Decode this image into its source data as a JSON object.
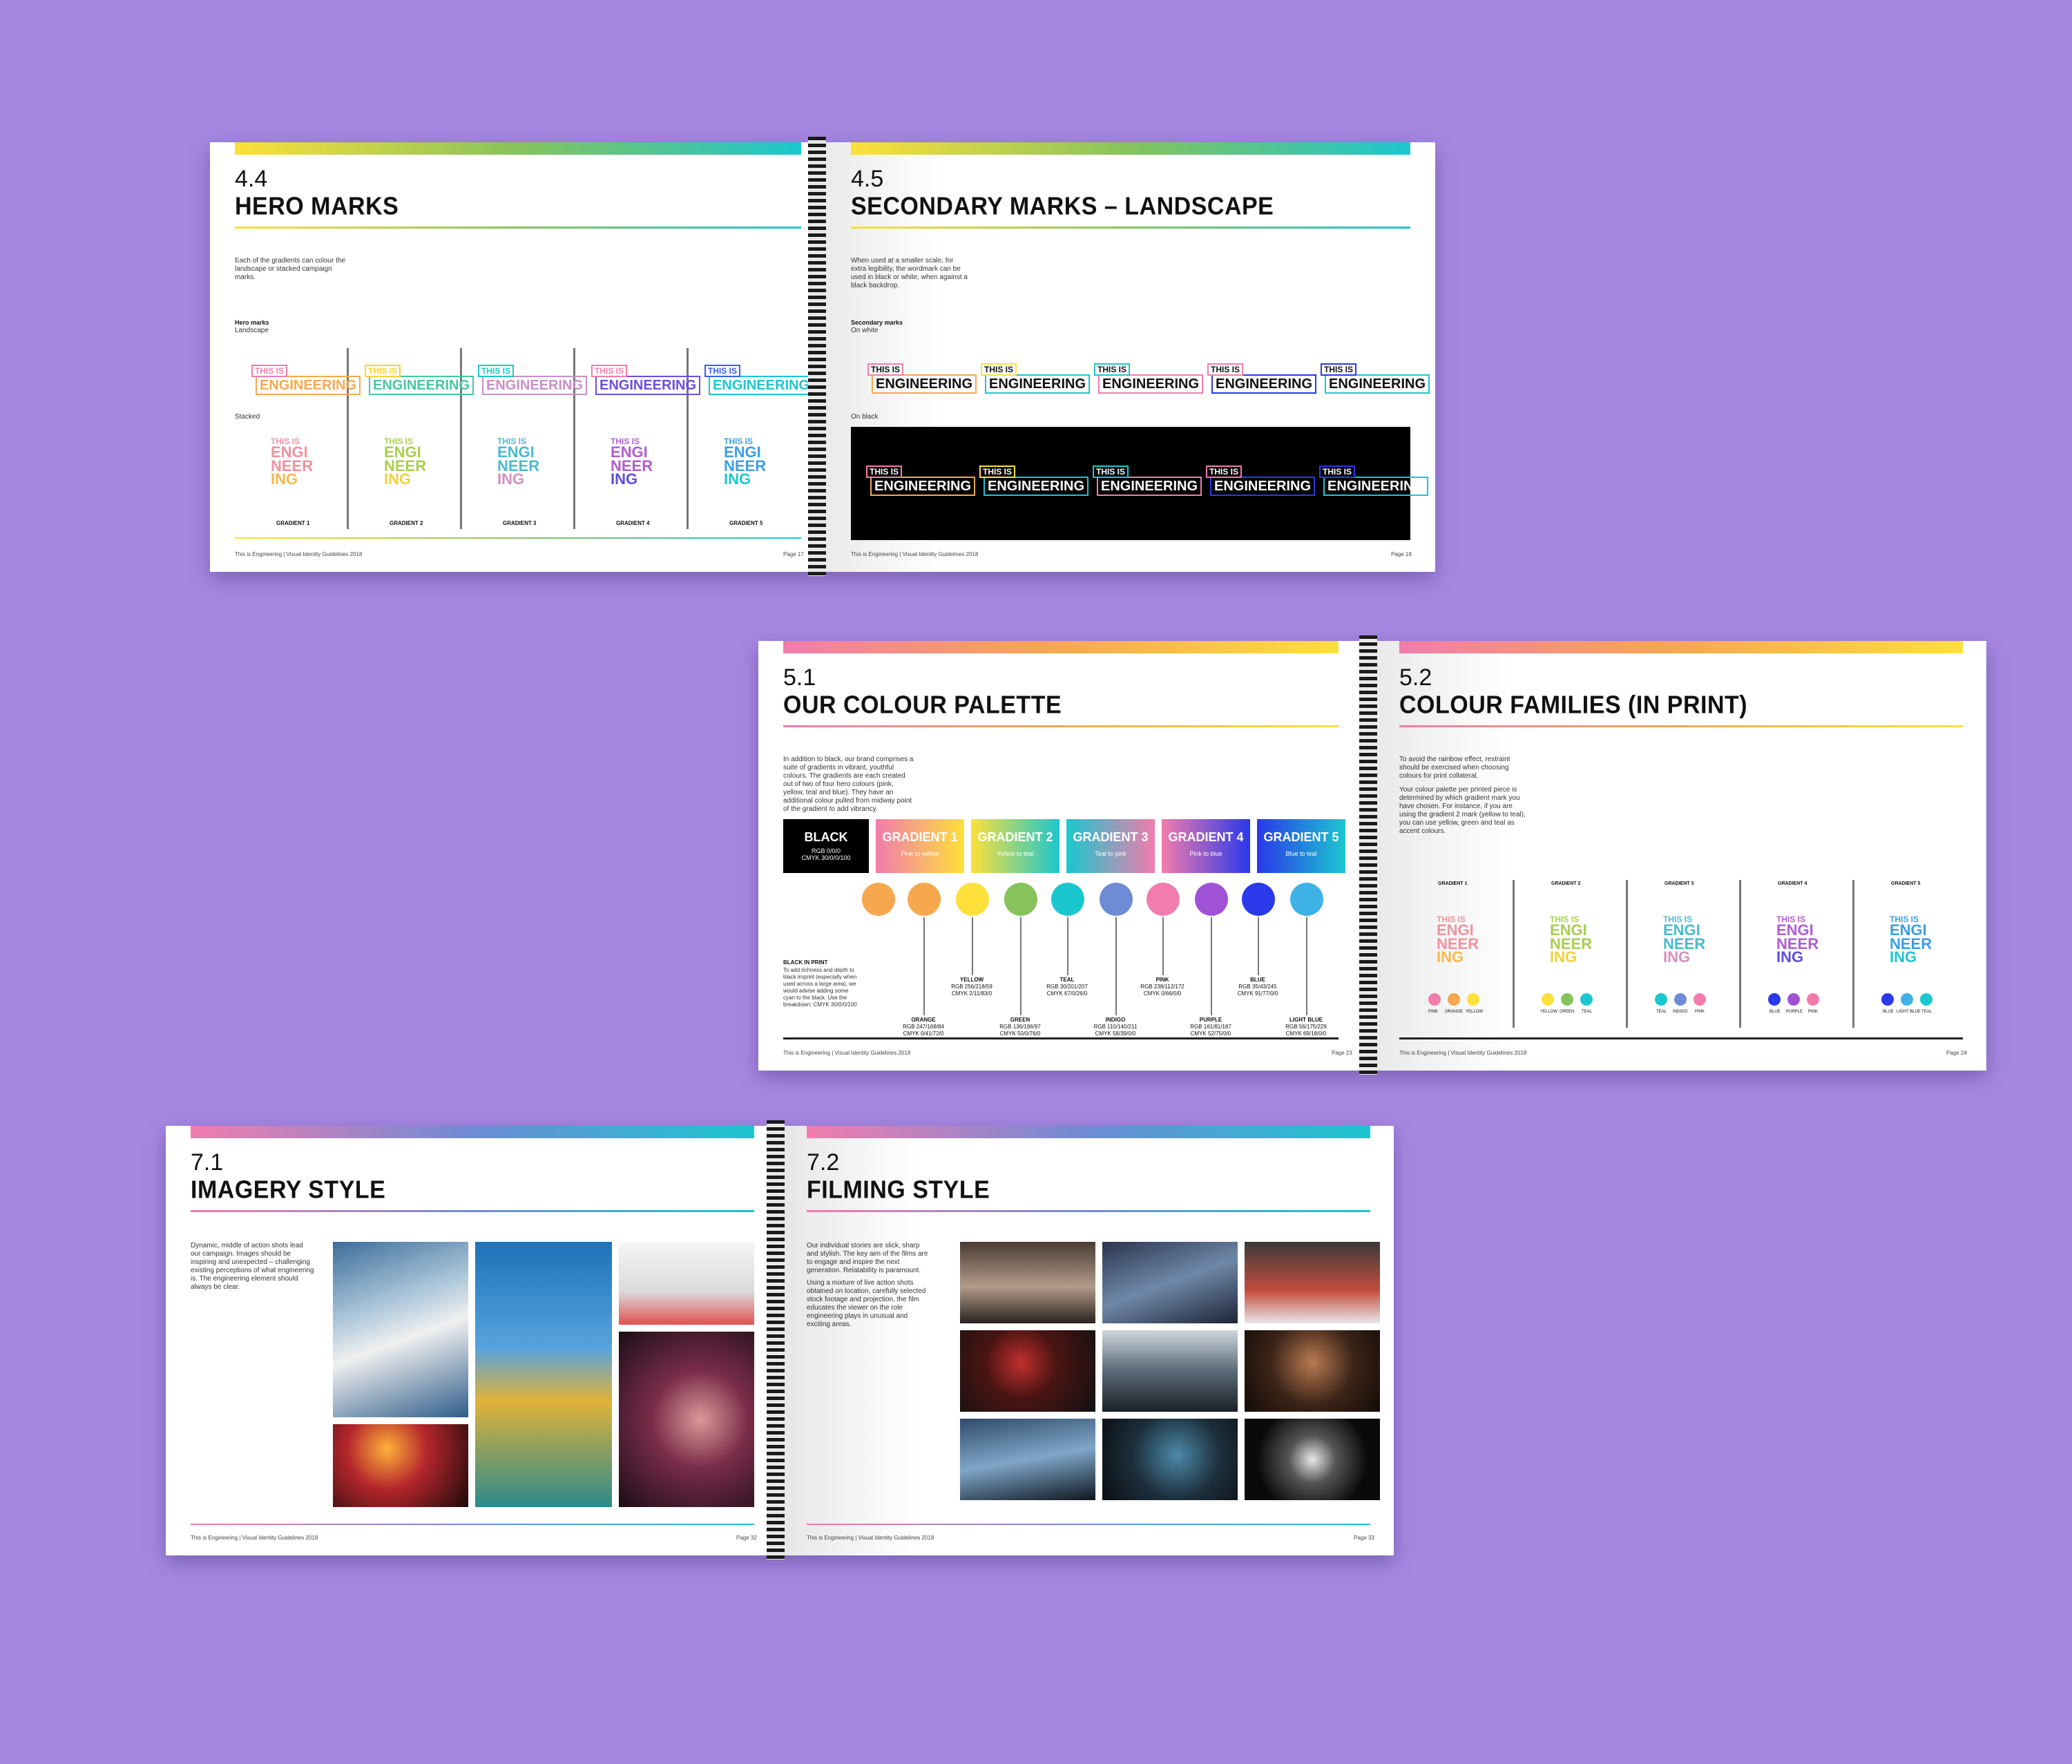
{
  "colors": {
    "background": "#a688e3",
    "pink": "#f27cad",
    "orange": "#f7a84e",
    "yellow": "#fde03a",
    "green": "#86c35b",
    "teal": "#1bc7cf",
    "indigo": "#6e8bd6",
    "purple": "#a052d6",
    "blue": "#2a39ea",
    "lightblue": "#3fb2e8",
    "black": "#000000"
  },
  "spread1": {
    "left": {
      "num": "4.4",
      "title": "HERO MARKS",
      "intro": "Each of the gradients can colour the landscape or stacked campaign marks.",
      "label_bold": "Hero marks",
      "label_sub": "Landscape",
      "stacked": "Stacked",
      "footer_left": "This is Engineering | Visual Identity Guidelines 2018",
      "footer_right": "Page 17",
      "gradients": [
        "GRADIENT 1",
        "GRADIENT 2",
        "GRADIENT 3",
        "GRADIENT 4",
        "GRADIENT 5"
      ]
    },
    "right": {
      "num": "4.5",
      "title": "SECONDARY MARKS – LANDSCAPE",
      "intro": "When used at a smaller scale, for extra legibility, the wordmark can be used in black or white, when against a black backdrop.",
      "label_bold": "Secondary marks",
      "label_sub": "On white",
      "on_black": "On black",
      "footer_left": "This is Engineering | Visual Identity Guidelines 2018",
      "footer_right": "Page 18"
    },
    "logo_line1": "THIS IS",
    "logo_line2": "ENGINEERING",
    "stack_lines": [
      "THIS IS",
      "ENGI",
      "NEER",
      "ING"
    ]
  },
  "spread2": {
    "left": {
      "num": "5.1",
      "title": "OUR COLOUR PALETTE",
      "intro": "In addition to black, our brand comprises a suite of gradients in vibrant, youthful colours. The gradients are each created out of two of four hero colours (pink, yellow, teal and blue). They have an additional colour pulled from midway point of the gradient to add vibrancy.",
      "swatches": [
        {
          "h": "BLACK",
          "s1": "RGB 0/0/0",
          "s2": "CMYK 30/0/0/100"
        },
        {
          "h": "GRADIENT 1",
          "s1": "Pink to yellow"
        },
        {
          "h": "GRADIENT 2",
          "s1": "Yellow to teal"
        },
        {
          "h": "GRADIENT 3",
          "s1": "Teal to pink"
        },
        {
          "h": "GRADIENT 4",
          "s1": "Pink to blue"
        },
        {
          "h": "GRADIENT 5",
          "s1": "Blue to teal"
        }
      ],
      "black_print_title": "BLACK IN PRINT",
      "black_print_body": "To add richness and depth to black imprint (especially when used across a large area), we would advise adding some cyan to the black. Use the breakdown: CMYK 30/0/0/100",
      "top_labels": [
        {
          "n": "YELLOW",
          "rgb": "RGB 256/218/59",
          "cmyk": "CMYK 2/11/83/0"
        },
        {
          "n": "TEAL",
          "rgb": "RGB 30/201/207",
          "cmyk": "CMYK 67/0/26/0"
        },
        {
          "n": "PINK",
          "rgb": "RGB 238/112/172",
          "cmyk": "CMYK 0/66/0/0"
        },
        {
          "n": "BLUE",
          "rgb": "RGB 35/43/245",
          "cmyk": "CMYK 91/77/0/0"
        }
      ],
      "bottom_labels": [
        {
          "n": "ORANGE",
          "rgb": "RGB 247/168/84",
          "cmyk": "CMYK 0/41/72/0"
        },
        {
          "n": "GREEN",
          "rgb": "RGB 136/196/97",
          "cmyk": "CMYK 50/0/76/0"
        },
        {
          "n": "INDIGO",
          "rgb": "RGB 110/140/211",
          "cmyk": "CMYK 58/39/0/0"
        },
        {
          "n": "PURPLE",
          "rgb": "RGB 161/81/187",
          "cmyk": "CMYK 52/75/0/0"
        },
        {
          "n": "LIGHT BLUE",
          "rgb": "RGB 56/175/229",
          "cmyk": "CMYK 69/18/0/0"
        }
      ],
      "footer_left": "This is Engineering | Visual Identity Guidelines 2018",
      "footer_right": "Page 23"
    },
    "right": {
      "num": "5.2",
      "title": "COLOUR FAMILIES (IN PRINT)",
      "intro1": "To avoid the rainbow effect, restraint should be exercised when choosing colours for print collateral.",
      "intro2": "Your colour palette per printed piece is determined by which gradient mark you have chosen. For instance, if you are using the gradient 2 mark (yellow to teal), you can use yellow, green and teal as accent colours.",
      "families": [
        {
          "g": "GRADIENT 1",
          "labels": [
            "PINK",
            "ORANGE",
            "YELLOW"
          ]
        },
        {
          "g": "GRADIENT 2",
          "labels": [
            "YELLOW",
            "GREEN",
            "TEAL"
          ]
        },
        {
          "g": "GRADIENT 3",
          "labels": [
            "TEAL",
            "INDIGO",
            "PINK"
          ]
        },
        {
          "g": "GRADIENT 4",
          "labels": [
            "BLUE",
            "PURPLE",
            "PINK"
          ]
        },
        {
          "g": "GRADIENT 5",
          "labels": [
            "BLUE",
            "LIGHT BLUE",
            "TEAL"
          ]
        }
      ],
      "footer_left": "This is Engineering | Visual Identity Guidelines 2018",
      "footer_right": "Page 24"
    }
  },
  "spread3": {
    "left": {
      "num": "7.1",
      "title": "IMAGERY STYLE",
      "intro": "Dynamic, middle of action shots lead our campaign. Images should be inspiring and unexpected – challenging existing perceptions of what engineering is. The engineering element should always be clear.",
      "footer_left": "This is Engineering | Visual Identity Guidelines 2018",
      "footer_right": "Page 32"
    },
    "right": {
      "num": "7.2",
      "title": "FILMING STYLE",
      "intro1": "Our individual stories are slick, sharp and stylish. The key aim of the films are to engage and inspire the next generation. Relatability is paramount.",
      "intro2": "Using a mixture of live action shots obtained on location, carefully selected stock footage and projection, the film educates the viewer on the role engineering plays in unusual and exciting areas.",
      "footer_left": "This is Engineering | Visual Identity Guidelines 2018",
      "footer_right": "Page 33"
    }
  }
}
